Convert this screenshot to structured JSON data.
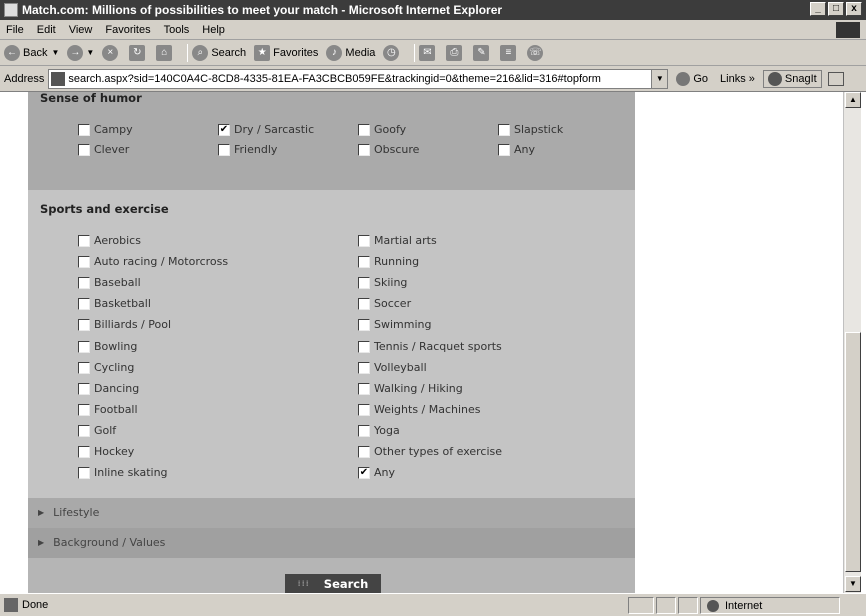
{
  "window": {
    "title": "Match.com: Millions of possibilities to meet your match - Microsoft Internet Explorer",
    "min": "_",
    "max": "□",
    "close": "x"
  },
  "menu": [
    "File",
    "Edit",
    "View",
    "Favorites",
    "Tools",
    "Help"
  ],
  "toolbar": {
    "back": "Back",
    "search": "Search",
    "favorites": "Favorites",
    "media": "Media"
  },
  "address": {
    "label": "Address",
    "url": "search.aspx?sid=140C0A4C-8CD8-4335-81EA-FA3CBCB059FE&trackingid=0&theme=216&lid=316#topform",
    "go": "Go",
    "links": "Links »",
    "snagit": "SnagIt"
  },
  "humor": {
    "title": "Sense of humor",
    "options": [
      {
        "label": "Campy",
        "checked": false
      },
      {
        "label": "Dry / Sarcastic",
        "checked": true
      },
      {
        "label": "Goofy",
        "checked": false
      },
      {
        "label": "Slapstick",
        "checked": false
      },
      {
        "label": "Clever",
        "checked": false
      },
      {
        "label": "Friendly",
        "checked": false
      },
      {
        "label": "Obscure",
        "checked": false
      },
      {
        "label": "Any",
        "checked": false
      }
    ]
  },
  "sports": {
    "title": "Sports and exercise",
    "left": [
      {
        "label": "Aerobics",
        "checked": false
      },
      {
        "label": "Auto racing / Motorcross",
        "checked": false
      },
      {
        "label": "Baseball",
        "checked": false
      },
      {
        "label": "Basketball",
        "checked": false
      },
      {
        "label": "Billiards / Pool",
        "checked": false
      },
      {
        "label": "Bowling",
        "checked": false
      },
      {
        "label": "Cycling",
        "checked": false
      },
      {
        "label": "Dancing",
        "checked": false
      },
      {
        "label": "Football",
        "checked": false
      },
      {
        "label": "Golf",
        "checked": false
      },
      {
        "label": "Hockey",
        "checked": false
      },
      {
        "label": "Inline skating",
        "checked": false
      }
    ],
    "right": [
      {
        "label": "Martial arts",
        "checked": false
      },
      {
        "label": "Running",
        "checked": false
      },
      {
        "label": "Skiing",
        "checked": false
      },
      {
        "label": "Soccer",
        "checked": false
      },
      {
        "label": "Swimming",
        "checked": false
      },
      {
        "label": "Tennis / Racquet sports",
        "checked": false
      },
      {
        "label": "Volleyball",
        "checked": false
      },
      {
        "label": "Walking / Hiking",
        "checked": false
      },
      {
        "label": "Weights / Machines",
        "checked": false
      },
      {
        "label": "Yoga",
        "checked": false
      },
      {
        "label": "Other types of exercise",
        "checked": false
      },
      {
        "label": "Any",
        "checked": true
      }
    ]
  },
  "collapsed": {
    "lifestyle": "Lifestyle",
    "background": "Background / Values"
  },
  "search_button": "Search",
  "status": {
    "text": "Done",
    "zone": "Internet"
  }
}
